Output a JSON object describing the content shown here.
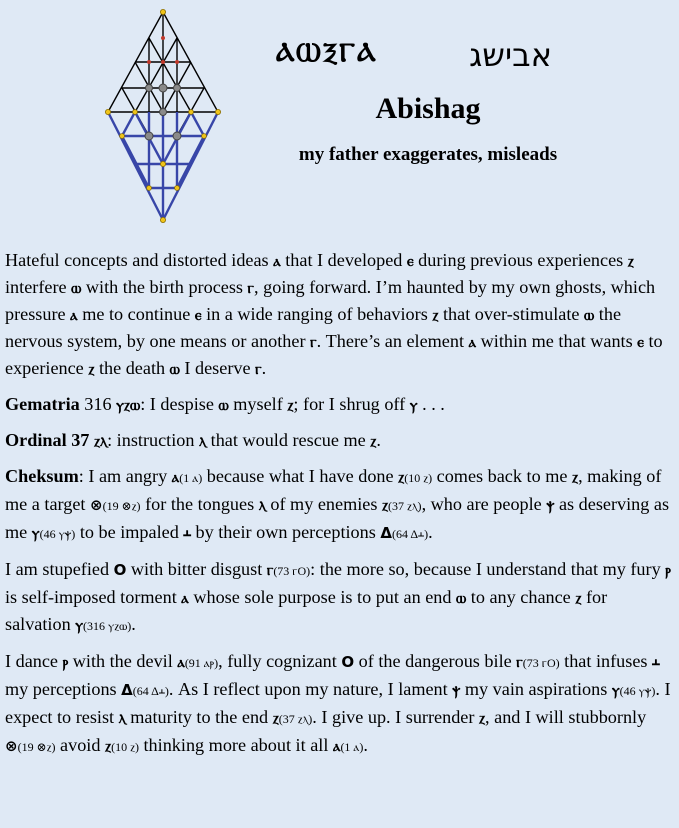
{
  "header": {
    "paleo_title": "ⲀⲰⲜⲄⲀ",
    "hebrew_title": "אבישג",
    "name": "Abishag",
    "meaning": "my father exaggerates, misleads"
  },
  "colors": {
    "background": "#dfe9f5",
    "grid_black": "#000000",
    "grid_blue": "#3846a8",
    "node_gold": "#f0c419",
    "node_gray": "#8a8a8a"
  },
  "paragraphs": [
    [
      {
        "t": "Hateful concepts and distorted ideas "
      },
      {
        "p": "ⲁ"
      },
      {
        "t": " that I developed "
      },
      {
        "p": "ⲉ"
      },
      {
        "t": " during previous experiences "
      },
      {
        "p": "ⲍ"
      },
      {
        "t": " interfere "
      },
      {
        "p": "ⲱ"
      },
      {
        "t": " with the birth process "
      },
      {
        "p": "ⲅ"
      },
      {
        "t": ", going forward. I’m haunted by my own ghosts, which pressure "
      },
      {
        "p": "ⲁ"
      },
      {
        "t": " me to continue "
      },
      {
        "p": "ⲉ"
      },
      {
        "t": " in a wide ranging of behaviors "
      },
      {
        "p": "ⲍ"
      },
      {
        "t": " that over-stimulate "
      },
      {
        "p": "ⲱ"
      },
      {
        "t": " the nervous system, by one means or another "
      },
      {
        "p": "ⲅ"
      },
      {
        "t": ". There’s an element "
      },
      {
        "p": "ⲁ"
      },
      {
        "t": " within me that wants "
      },
      {
        "p": "ⲉ"
      },
      {
        "t": " to experience "
      },
      {
        "p": "ⲍ"
      },
      {
        "t": " the death "
      },
      {
        "p": "ⲱ"
      },
      {
        "t": " I deserve "
      },
      {
        "p": "ⲅ"
      },
      {
        "t": "."
      }
    ],
    [
      {
        "b": "Gematria"
      },
      {
        "t": " 316 "
      },
      {
        "p": "ⲩⲍⲱ"
      },
      {
        "t": ": I despise "
      },
      {
        "p": "ⲱ"
      },
      {
        "t": " myself "
      },
      {
        "p": "ⲍ"
      },
      {
        "t": "; for I shrug off "
      },
      {
        "p": "ⲩ"
      },
      {
        "t": " . . ."
      }
    ],
    [
      {
        "b": "Ordinal 37 "
      },
      {
        "p": "ⲍⲗ"
      },
      {
        "t": ": instruction "
      },
      {
        "p": "ⲗ"
      },
      {
        "t": " that would rescue me "
      },
      {
        "p": "ⲍ"
      },
      {
        "t": "."
      }
    ],
    [
      {
        "b": "Cheksum"
      },
      {
        "t": ": I am angry "
      },
      {
        "p": "ⲁ"
      },
      {
        "s": "(1 ⲁ)"
      },
      {
        "t": " because what I have done "
      },
      {
        "p": "ⲍ"
      },
      {
        "s": "(10 ⲍ)"
      },
      {
        "t": " comes back to me "
      },
      {
        "p": "ⲍ"
      },
      {
        "t": ", making of me a target "
      },
      {
        "p": "⊗"
      },
      {
        "s": "(19 ⊗ⲍ)"
      },
      {
        "t": " for the tongues "
      },
      {
        "p": "ⲗ"
      },
      {
        "t": " of my enemies "
      },
      {
        "p": "ⲍ"
      },
      {
        "s": "(37 ⲍⲗ)"
      },
      {
        "t": ", who are people "
      },
      {
        "p": "ⲯ"
      },
      {
        "t": " as deserving as me "
      },
      {
        "p": "ⲩ"
      },
      {
        "s": "(46 ⲩⲯ)"
      },
      {
        "t": " to be impaled "
      },
      {
        "p": "ⲳ"
      },
      {
        "t": " by their own perceptions "
      },
      {
        "p": "Δ"
      },
      {
        "s": "(64 Δⲳ)"
      },
      {
        "t": "."
      }
    ],
    [
      {
        "t": "I am stupefied "
      },
      {
        "p": "O"
      },
      {
        "t": " with bitter disgust "
      },
      {
        "p": "ⲅ"
      },
      {
        "s": "(73 ⲅO)"
      },
      {
        "t": ": the more so, because I understand that my fury "
      },
      {
        "p": "ⲣ"
      },
      {
        "t": " is self-imposed torment "
      },
      {
        "p": "ⲁ"
      },
      {
        "t": " whose sole purpose is to put an end "
      },
      {
        "p": "ⲱ"
      },
      {
        "t": " to any chance "
      },
      {
        "p": "ⲍ"
      },
      {
        "t": " for salvation "
      },
      {
        "p": "ⲩ"
      },
      {
        "s": "(316 ⲩⲍⲱ)"
      },
      {
        "t": "."
      }
    ],
    [
      {
        "t": "I dance "
      },
      {
        "p": "ⲣ"
      },
      {
        "t": " with the devil "
      },
      {
        "p": "ⲁ"
      },
      {
        "s": "(91 ⲁⲣ)"
      },
      {
        "t": ", fully cognizant "
      },
      {
        "p": "O"
      },
      {
        "t": " of the dangerous bile "
      },
      {
        "p": "ⲅ"
      },
      {
        "s": "(73 ⲅO)"
      },
      {
        "t": " that infuses "
      },
      {
        "p": "ⲳ"
      },
      {
        "t": " my perceptions "
      },
      {
        "p": "Δ"
      },
      {
        "s": "(64 Δⲳ)"
      },
      {
        "t": ". As I reflect upon my nature, I lament "
      },
      {
        "p": "ⲯ"
      },
      {
        "t": " my vain aspirations "
      },
      {
        "p": "ⲩ"
      },
      {
        "s": "(46 ⲩⲯ)"
      },
      {
        "t": ". I expect to resist "
      },
      {
        "p": "ⲗ"
      },
      {
        "t": " maturity to the end "
      },
      {
        "p": "ⲍ"
      },
      {
        "s": "(37 ⲍⲗ)"
      },
      {
        "t": ". I give up. I surrender "
      },
      {
        "p": "ⲍ"
      },
      {
        "t": ", and I will stubbornly "
      },
      {
        "p": "⊗"
      },
      {
        "s": "(19 ⊗ⲍ)"
      },
      {
        "t": " avoid "
      },
      {
        "p": "ⲍ"
      },
      {
        "s": "(10 ⲍ)"
      },
      {
        "t": " thinking more about it all "
      },
      {
        "p": "ⲁ"
      },
      {
        "s": "(1 ⲁ)"
      },
      {
        "t": "."
      }
    ]
  ]
}
